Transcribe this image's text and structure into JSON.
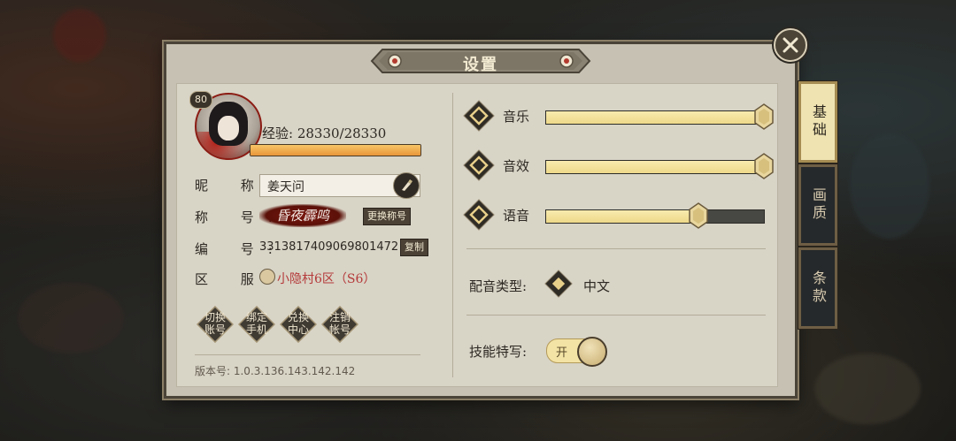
{
  "settings": {
    "title": "设置",
    "player": {
      "level": "80",
      "exp_text": "经验: 28330/28330",
      "exp_progress": 1.0,
      "nickname_label": "昵  称:",
      "nickname_value": "姜天问",
      "title_label": "称  号:",
      "title_value": "昏夜霹鸣",
      "change_title_button": "更换称号",
      "id_label": "编  号:",
      "id_value": "3313817409069801472",
      "copy_button": "复制",
      "server_label": "区  服:",
      "server_value": "小隐村6区（S6）"
    },
    "account_buttons": [
      {
        "line1": "切换",
        "line2": "账号"
      },
      {
        "line1": "绑定",
        "line2": "手机"
      },
      {
        "line1": "兑换",
        "line2": "中心"
      },
      {
        "line1": "注销",
        "line2": "帐号"
      }
    ],
    "version": "版本号: 1.0.3.136.143.142.142",
    "audio": {
      "music_label": "音乐",
      "music_level": 1.0,
      "sfx_label": "音效",
      "sfx_level": 1.0,
      "voice_label": "语音",
      "voice_level": 0.7
    },
    "voice_type_label": "配音类型:",
    "voice_type_value": "中文",
    "skill_closeup_label": "技能特写:",
    "skill_closeup_toggle": "开",
    "tabs": [
      "基础",
      "画质",
      "条款"
    ],
    "active_tab": "基础"
  }
}
